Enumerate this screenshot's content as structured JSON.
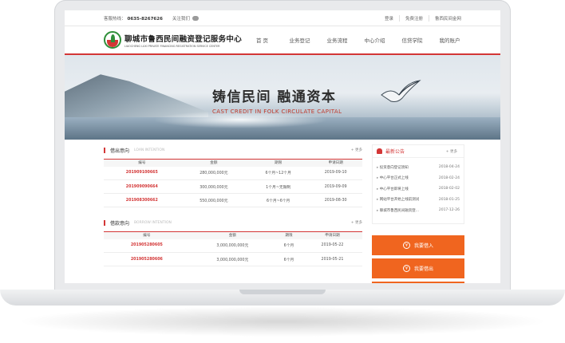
{
  "topbar": {
    "hotline_label": "客服热线：",
    "hotline_number": "0635-8267626",
    "follow_label": "关注我们",
    "links": [
      "登录",
      "免费注册",
      "鲁西民间金网"
    ]
  },
  "header": {
    "logo_cn": "聊城市鲁西民间融资登记服务中心",
    "logo_en": "LIAOCHENG LUXI PRIVATE FINANCING REGISTRATION SERVICE CENTER",
    "nav": [
      "首 页",
      "业务登记",
      "业务流程",
      "中心介绍",
      "信贷学院",
      "我的账户"
    ]
  },
  "banner": {
    "slogan_cn": "铸信民间 融通资本",
    "slogan_en": "CAST CREDIT IN FOLK   CIRCULATE CAPITAL"
  },
  "loan": {
    "title": "借出意向",
    "title_en": "LOAN INTENTION",
    "more": "+ 更多",
    "headers": [
      "编号",
      "金额",
      "期限",
      "申请日期"
    ],
    "rows": [
      [
        "201909100665",
        "280,000,000元",
        "6个月~12个月",
        "2019-09-10"
      ],
      [
        "201909090664",
        "300,000,000元",
        "1个月~无限制",
        "2019-09-09"
      ],
      [
        "201908300662",
        "550,000,000元",
        "6个月~6个月",
        "2019-08-30"
      ]
    ]
  },
  "borrow": {
    "title": "借款意向",
    "title_en": "BORROW INTENTION",
    "more": "+ 更多",
    "headers": [
      "编号",
      "金额",
      "期限",
      "申请日期"
    ],
    "rows": [
      [
        "201905280605",
        "3,000,000,000元",
        "6个月",
        "2019-05-22"
      ],
      [
        "201905280606",
        "3,000,000,000元",
        "6个月",
        "2019-05-21"
      ]
    ]
  },
  "notice": {
    "title": "最新公告",
    "more": "+ 更多",
    "items": [
      [
        "投资意向登记须知",
        "2018-04-24"
      ],
      [
        "中心平台正式上线",
        "2018-02-24"
      ],
      [
        "中心平台即将上线",
        "2018-02-02"
      ],
      [
        "网站平台开始上线前测试",
        "2018-01-25"
      ],
      [
        "聊城市鲁西民间融资登...",
        "2017-12-26"
      ]
    ]
  },
  "actions": {
    "invest": "我要借入",
    "lend": "我要借出"
  }
}
